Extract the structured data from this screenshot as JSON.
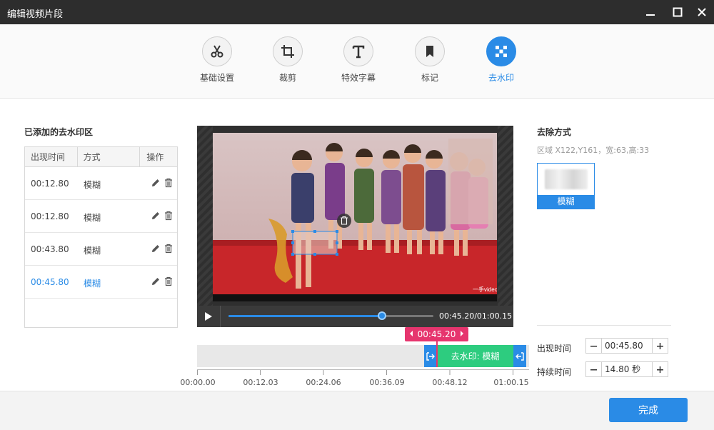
{
  "window": {
    "title": "编辑视频片段"
  },
  "toolbar": {
    "tools": [
      {
        "label": "基础设置",
        "icon": "scissors-icon"
      },
      {
        "label": "裁剪",
        "icon": "crop-icon"
      },
      {
        "label": "特效字幕",
        "icon": "text-icon"
      },
      {
        "label": "标记",
        "icon": "bookmark-icon"
      },
      {
        "label": "去水印",
        "icon": "mosaic-icon",
        "active": true
      }
    ]
  },
  "left": {
    "title": "已添加的去水印区",
    "columns": [
      "出现时间",
      "方式",
      "操作"
    ],
    "rows": [
      {
        "time": "00:12.80",
        "method": "模糊"
      },
      {
        "time": "00:12.80",
        "method": "模糊"
      },
      {
        "time": "00:43.80",
        "method": "模糊"
      },
      {
        "time": "00:45.80",
        "method": "模糊",
        "selected": true
      }
    ]
  },
  "player": {
    "time_display": "00:45.20/01:00.15",
    "progress": 0.75
  },
  "timeline": {
    "cursor_time": "00:45.20",
    "segment_label": "去水印: 模糊",
    "ticks": [
      "00:00.00",
      "00:12.03",
      "00:24.06",
      "00:36.09",
      "00:48.12",
      "01:00.15"
    ]
  },
  "right": {
    "title": "去除方式",
    "region_info": "区域 X122,Y161，宽:63,高:33",
    "method": "模糊",
    "start_label": "出现时间",
    "start_value": "00:45.80",
    "duration_label": "持续时间",
    "duration_value": "14.80 秒"
  },
  "footer": {
    "done_label": "完成"
  },
  "colors": {
    "accent": "#2a8be6",
    "segment": "#2dcc7f",
    "cursor": "#e6356e"
  }
}
